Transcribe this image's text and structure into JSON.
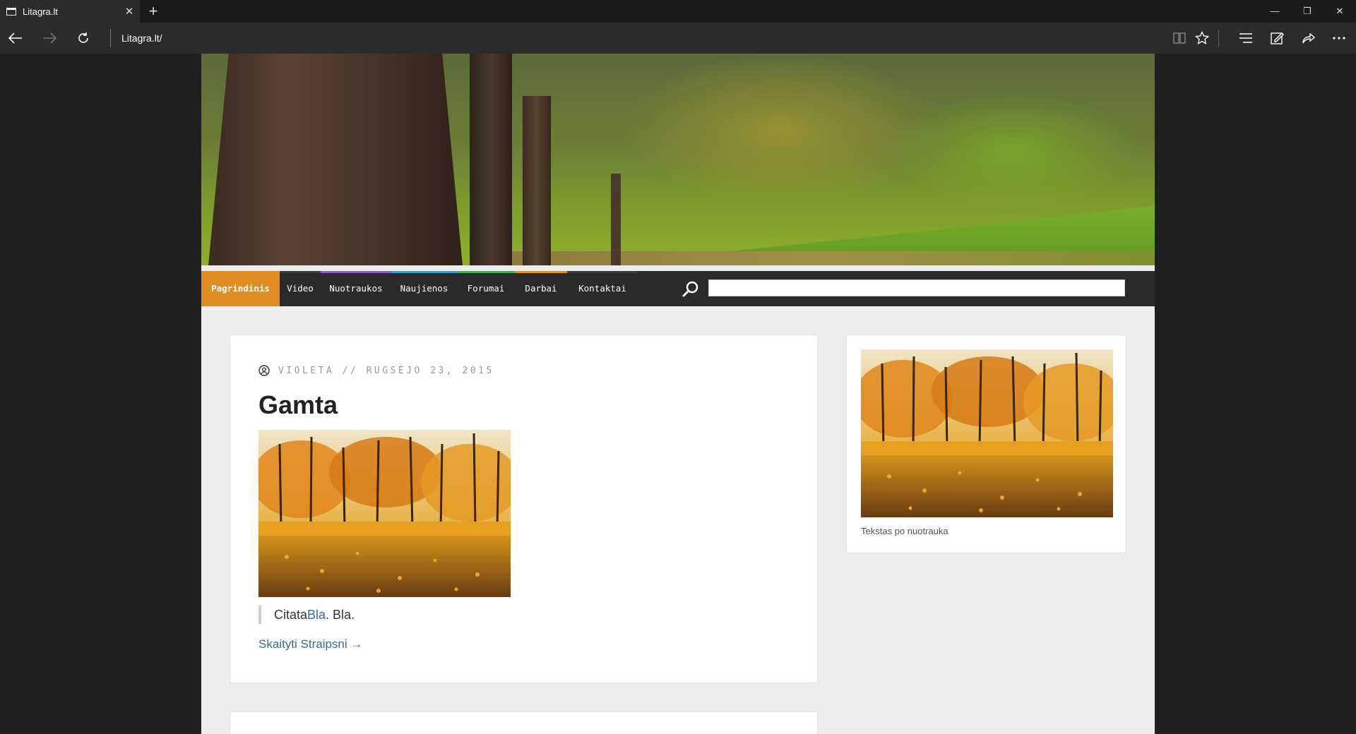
{
  "browser": {
    "tab_title": "Litagra.lt",
    "tab_close": "✕",
    "new_tab": "+",
    "url": "Litagra.lt/",
    "minimize": "—",
    "restore": "❐",
    "close": "✕"
  },
  "menu": {
    "items": [
      {
        "label": "Pagrindinis",
        "color": "#e08e20"
      },
      {
        "label": "Video",
        "color": "#3b3b3b"
      },
      {
        "label": "Nuotraukos",
        "color": "#8a5bc4"
      },
      {
        "label": "Naujienos",
        "color": "#3aa0c8"
      },
      {
        "label": "Forumai",
        "color": "#3fae54"
      },
      {
        "label": "Darbai",
        "color": "#e08e20"
      },
      {
        "label": "Kontaktai",
        "color": "#3b3b3b"
      }
    ],
    "search_placeholder": ""
  },
  "post": {
    "meta": "Violeta // Rugsėjo 23, 2015",
    "title": "Gamta",
    "quote_prefix": "Citata",
    "quote_link": "Bla",
    "quote_suffix": ". Bla.",
    "read_more": "Skaityti Straipsni →"
  },
  "sidebar": {
    "caption": "Tekstas po nuotrauka"
  },
  "colors": {
    "accent": "#e08e20",
    "link": "#3a6a9e"
  }
}
